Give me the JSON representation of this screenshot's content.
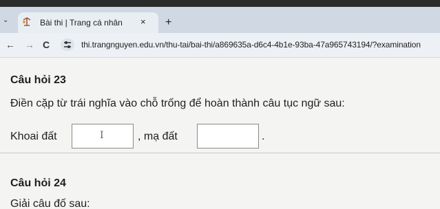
{
  "browser": {
    "tab": {
      "title": "Bài thi | Trang cá nhân",
      "close": "×",
      "favicon": "lamp-icon"
    },
    "new_tab": "+",
    "tab_menu": "⌄",
    "nav": {
      "back": "←",
      "forward": "→",
      "reload": "C"
    },
    "url": "thi.trangnguyen.edu.vn/thu-tai/bai-thi/a869635a-d6c4-4b1e-93ba-47a965743194/?examination"
  },
  "questions": [
    {
      "title": "Câu hỏi 23",
      "prompt": "Điền cặp từ trái nghĩa vào chỗ trống để hoàn thành câu tục ngữ sau:",
      "part1": "Khoai đất",
      "part2": ", mạ đất",
      "part3": ".",
      "cursor": "I"
    },
    {
      "title": "Câu hỏi 24",
      "prompt": "Giải câu đố sau:"
    }
  ]
}
